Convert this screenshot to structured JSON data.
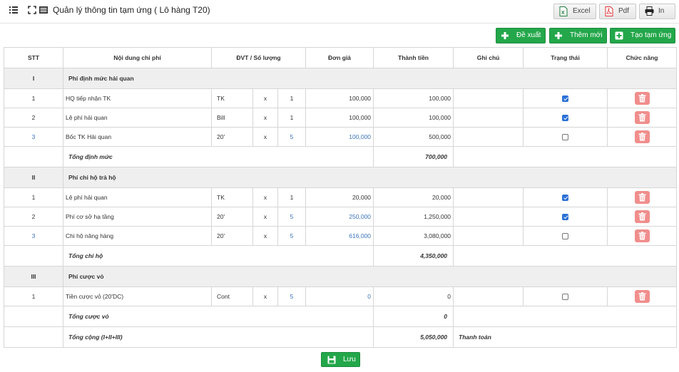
{
  "header": {
    "title": "Quản lý thông tin tạm ứng ( Lô hàng T20)",
    "excel_label": "Excel",
    "pdf_label": "Pdf",
    "print_label": "In"
  },
  "actions": {
    "propose_label": "Đề xuất",
    "add_new_label": "Thêm mới",
    "create_advance_label": "Tạo tạm ứng",
    "save_label": "Lưu"
  },
  "columns": [
    "STT",
    "Nội dung chi phí",
    "ĐVT / Số lượng",
    "Đơn giá",
    "Thành tiền",
    "Ghi chú",
    "Trạng thái",
    "Chức năng"
  ],
  "groups": [
    {
      "roman": "I",
      "name": "Phí định mức hải quan",
      "items": [
        {
          "stt": "1",
          "content": "HQ tiếp nhận TK",
          "unit": "TK",
          "x": "x",
          "qty": "1",
          "price": "100,000",
          "amount": "100,000",
          "checked": true
        },
        {
          "stt": "2",
          "content": "Lệ phí hải quan",
          "unit": "Bill",
          "x": "x",
          "qty": "1",
          "price": "100,000",
          "amount": "100,000",
          "checked": true
        },
        {
          "stt": "3",
          "content": "Bốc TK Hải quan",
          "unit": "20'",
          "x": "x",
          "qty": "5",
          "price": "100,000",
          "amount": "500,000",
          "checked": false
        }
      ],
      "total_label": "Tổng định mức",
      "total_value": "700,000"
    },
    {
      "roman": "II",
      "name": "Phí chi hộ trả hộ",
      "items": [
        {
          "stt": "1",
          "content": "Lệ phí hải quan",
          "unit": "TK",
          "x": "x",
          "qty": "1",
          "price": "20,000",
          "amount": "20,000",
          "checked": true
        },
        {
          "stt": "2",
          "content": "Phí cơ sở hạ tầng",
          "unit": "20'",
          "x": "x",
          "qty": "5",
          "price": "250,000",
          "amount": "1,250,000",
          "checked": true
        },
        {
          "stt": "3",
          "content": "Chi hộ nâng hàng",
          "unit": "20'",
          "x": "x",
          "qty": "5",
          "price": "616,000",
          "amount": "3,080,000",
          "checked": false
        }
      ],
      "total_label": "Tổng chi hộ",
      "total_value": "4,350,000"
    },
    {
      "roman": "III",
      "name": "Phí cược vỏ",
      "items": [
        {
          "stt": "1",
          "content": "Tiền cược vỏ (20'DC)",
          "unit": "Cont",
          "x": "x",
          "qty": "5",
          "price": "0",
          "amount": "0",
          "checked": false
        }
      ],
      "total_label": "Tổng cược vỏ",
      "total_value": "0"
    }
  ],
  "grand_total": {
    "label": "Tổng cộng (I+II+III)",
    "value": "5,050,000",
    "note": "Thanh toán"
  },
  "colors": {
    "green": "#23a74a",
    "delete_red": "#f08e8c",
    "link_blue": "#3a72b8",
    "checkbox_blue": "#2b71d5"
  },
  "icons": [
    "menu-icon",
    "fullscreen-icon",
    "list-icon",
    "excel-icon",
    "pdf-icon",
    "print-icon",
    "plus-icon",
    "trash-icon",
    "save-icon"
  ]
}
